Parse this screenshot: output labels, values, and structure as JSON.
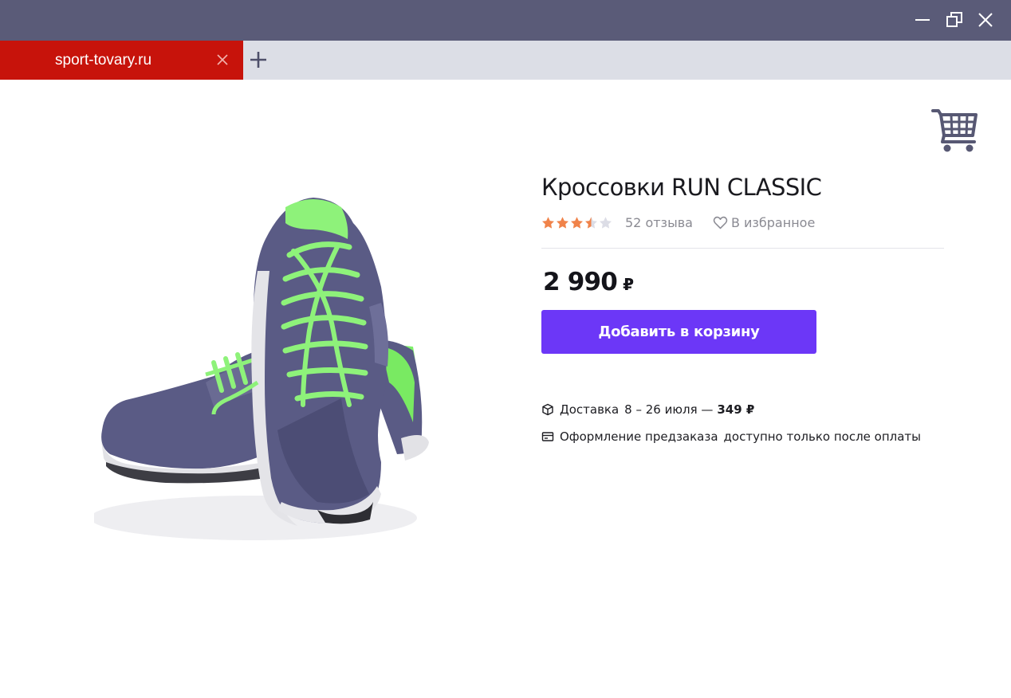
{
  "window": {
    "controls": {
      "minimize_icon": "minimize-icon",
      "maximize_icon": "restore-icon",
      "close_icon": "close-icon"
    },
    "titlebar_color": "#5a5b78"
  },
  "tabs": [
    {
      "label": "sport-tovary.ru",
      "active": true,
      "color": "#c7130b"
    }
  ],
  "new_tab_icon": "plus-icon",
  "header": {
    "cart_icon": "shopping-cart-icon"
  },
  "product": {
    "title": "Кроссовки RUN CLASSIC",
    "rating": 3.5,
    "rating_max": 5,
    "reviews": "52 отзыва",
    "favorite_label": "В избранное",
    "price": "2 990",
    "currency": "₽",
    "add_to_cart_label": "Добавить в корзину",
    "accent_color": "#6c37f7",
    "star_color": "#f0834a"
  },
  "delivery": {
    "label": "Доставка",
    "dates": "8 – 26 июля —",
    "cost": "349 ₽"
  },
  "preorder": {
    "label": "Оформление предзаказа",
    "note": "доступно только после оплаты"
  }
}
